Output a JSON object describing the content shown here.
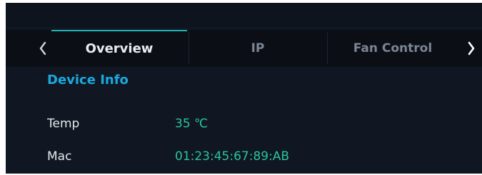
{
  "tabs": {
    "items": [
      {
        "label": "Overview",
        "active": true
      },
      {
        "label": "IP",
        "active": false
      },
      {
        "label": "Fan Control",
        "active": false
      }
    ],
    "prev_icon": "chevron-left-icon",
    "next_icon": "chevron-right-icon"
  },
  "section": {
    "title": "Device Info"
  },
  "info": {
    "temp": {
      "label": "Temp",
      "value": "35 ℃"
    },
    "mac": {
      "label": "Mac",
      "value": "01:23:45:67:89:AB"
    }
  },
  "colors": {
    "background": "#101722",
    "accent": "#22b5b9",
    "section_title": "#1aa9de",
    "value": "#2ac39f",
    "label": "#e5e8ec",
    "inactive_tab": "#7b8595"
  }
}
